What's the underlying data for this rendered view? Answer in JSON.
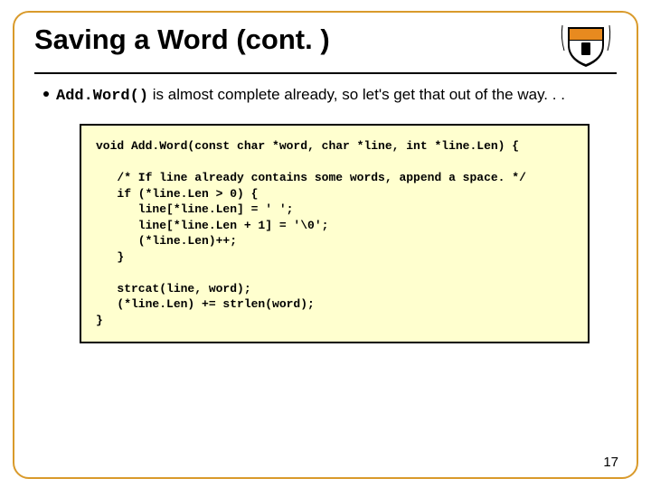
{
  "title": "Saving a Word (cont. )",
  "bullet": {
    "code": "Add.Word()",
    "rest": " is almost complete already, so let's get that out of the way. . ."
  },
  "codebox": "void Add.Word(const char *word, char *line, int *line.Len) {\n\n   /* If line already contains some words, append a space. */\n   if (*line.Len > 0) {\n      line[*line.Len] = ' ';\n      line[*line.Len + 1] = '\\0';\n      (*line.Len)++;\n   }\n\n   strcat(line, word);\n   (*line.Len) += strlen(word);\n}",
  "page_number": "17",
  "logo_label": "Princeton shield"
}
